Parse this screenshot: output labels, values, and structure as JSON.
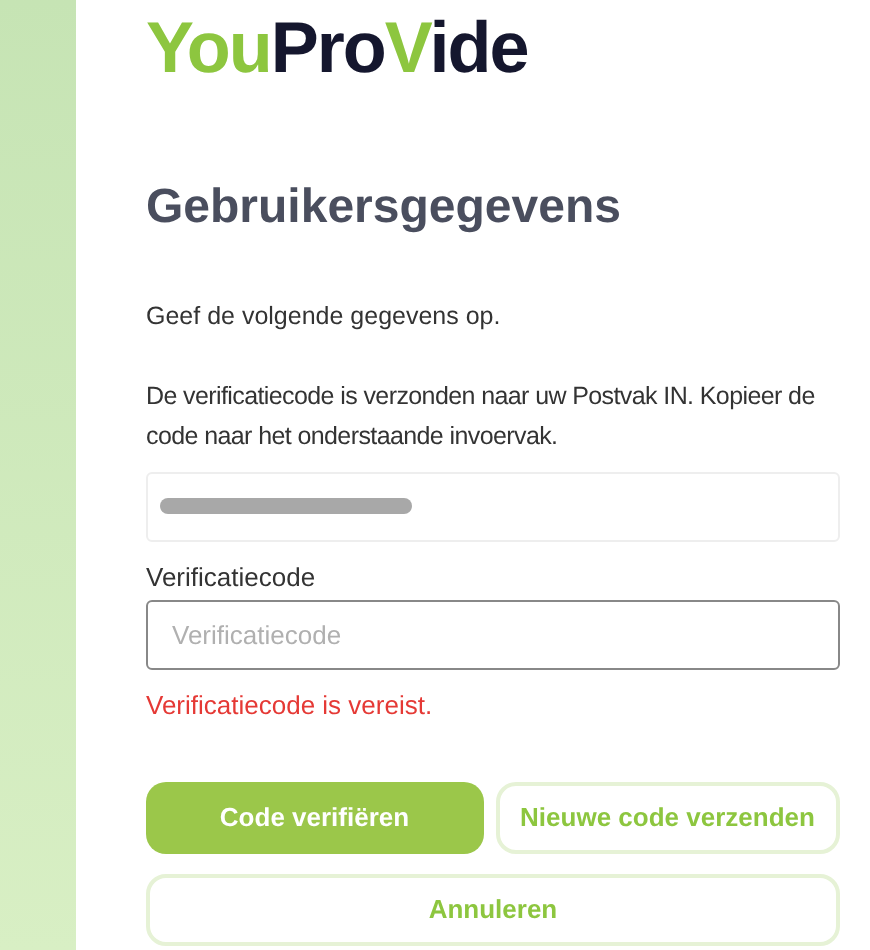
{
  "logo": {
    "parts": [
      {
        "text": "You",
        "accent": true
      },
      {
        "text": "Pro",
        "accent": false
      },
      {
        "text": "V",
        "accent": true
      },
      {
        "text": "ide",
        "accent": false
      }
    ]
  },
  "heading": "Gebruikersgegevens",
  "intro": "Geef de volgende gegevens op.",
  "notice": "De verificatiecode is verzonden naar uw Postvak IN. Kopieer de code naar het onderstaande invoervak.",
  "email_field": {
    "redacted": true
  },
  "code_field": {
    "label": "Verificatiecode",
    "placeholder": "Verificatiecode"
  },
  "error": "Verificatiecode is vereist.",
  "buttons": [
    {
      "label": "Code verifiëren",
      "kind": "primary"
    },
    {
      "label": "Nieuwe code verzenden",
      "kind": "secondary"
    },
    {
      "label": "Annuleren",
      "kind": "wide"
    }
  ]
}
